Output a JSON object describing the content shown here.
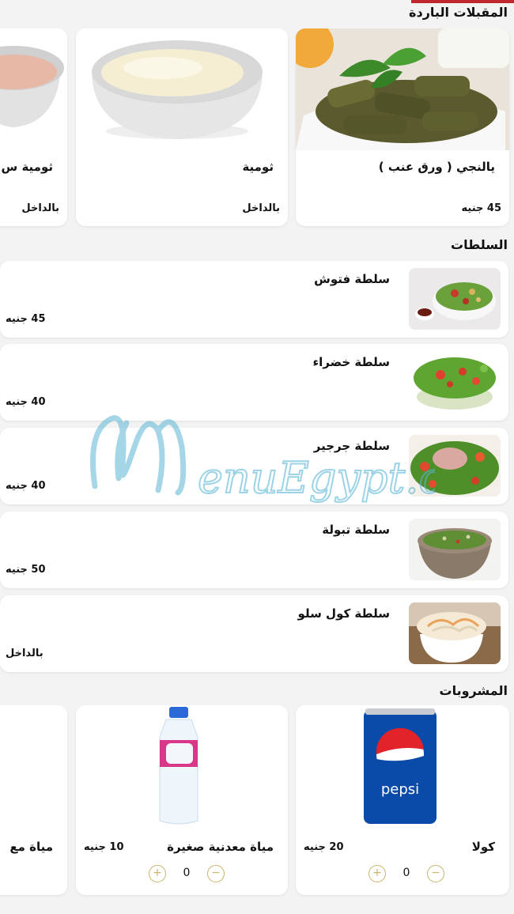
{
  "sections": {
    "cold_appetizers": {
      "title": "المقبلات الباردة",
      "items": [
        {
          "name": "يالنجي ( ورق عنب )",
          "price": "45 جنيه",
          "image": "stuffed-grape-leaves-image"
        },
        {
          "name": "ثومية",
          "price": "بالداخل",
          "image": "garlic-sauce-image"
        },
        {
          "name": "ثومية س",
          "price": "بالداخل",
          "image": "sauce-image"
        }
      ]
    },
    "salads": {
      "title": "السلطات",
      "items": [
        {
          "name": "سلطة فتوش",
          "price": "45 جنيه",
          "image": "fattoush-image"
        },
        {
          "name": "سلطة خضراء",
          "price": "40 جنيه",
          "image": "green-salad-image"
        },
        {
          "name": "سلطة جرجير",
          "price": "40 جنيه",
          "image": "arugula-salad-image"
        },
        {
          "name": "سلطة تبولة",
          "price": "50 جنيه",
          "image": "tabbouleh-image"
        },
        {
          "name": "سلطة كول سلو",
          "price": "بالداخل",
          "image": "coleslaw-image"
        }
      ]
    },
    "drinks": {
      "title": "المشروبات",
      "items": [
        {
          "name": "كولا",
          "price": "20 جنيه",
          "qty": "0",
          "image": "pepsi-can-image"
        },
        {
          "name": "مياة معدنية صغيرة",
          "price": "10 جنيه",
          "qty": "0",
          "image": "water-bottle-image"
        },
        {
          "name": "مياة مع",
          "price": "",
          "qty": "",
          "image": "water-image"
        }
      ]
    }
  },
  "controls": {
    "plus": "+",
    "minus": "−"
  },
  "watermark": "MenuEgypt.com",
  "colors": {
    "accent": "#c0282d",
    "qty_button": "#c9b46a",
    "watermark": "#5bb6d6"
  }
}
